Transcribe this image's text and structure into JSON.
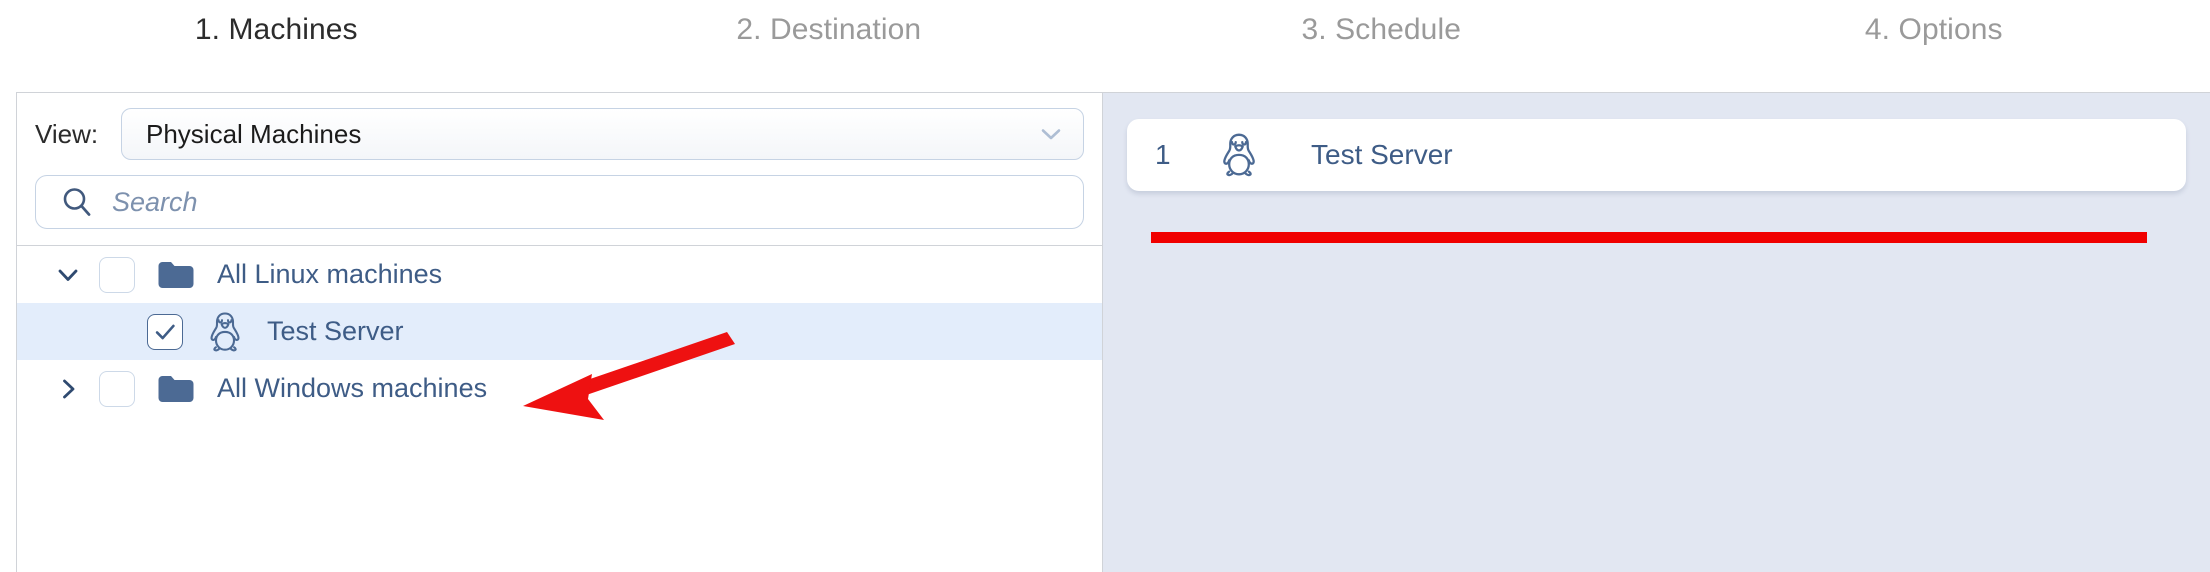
{
  "steps": [
    {
      "label": "1. Machines",
      "active": true
    },
    {
      "label": "2. Destination",
      "active": false
    },
    {
      "label": "3. Schedule",
      "active": false
    },
    {
      "label": "4. Options",
      "active": false
    }
  ],
  "filter": {
    "view_label": "View:",
    "view_value": "Physical Machines",
    "view_chevron_icon": "chevron-down-icon",
    "search_value": "",
    "search_placeholder": "Search",
    "search_icon": "search-icon"
  },
  "tree": {
    "rows": [
      {
        "label": "All Linux machines",
        "icon": "folder-icon",
        "twisty": "chevron-down-icon",
        "checked": false,
        "selected": false,
        "depth": 0
      },
      {
        "label": "Test Server",
        "icon": "tux-penguin-icon",
        "twisty": "none",
        "checked": true,
        "selected": true,
        "depth": 1
      },
      {
        "label": "All Windows machines",
        "icon": "folder-icon",
        "twisty": "chevron-right-icon",
        "checked": false,
        "selected": false,
        "depth": 0
      }
    ]
  },
  "selection_panel": {
    "items": [
      {
        "index": "1",
        "icon": "tux-penguin-icon",
        "label": "Test Server"
      }
    ]
  },
  "annotations": {
    "underline_color": "#f00000",
    "arrow_color": "#ee1111"
  },
  "colors": {
    "accent_blue": "#3e5c86",
    "folder_blue": "#4c6a94",
    "right_panel_bg": "#e2e7f2",
    "selected_row_bg": "#e3edfb",
    "border": "#d0d3d8",
    "field_border": "#c6d3e4",
    "active_step_text": "#2c2c2c",
    "inactive_step_text": "#9a9a9a"
  }
}
